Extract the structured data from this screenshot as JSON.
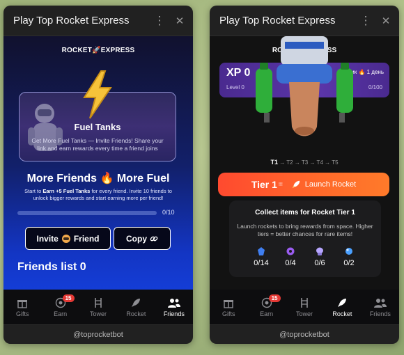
{
  "left": {
    "title": "Play Top Rocket Express",
    "logo": {
      "part1": "ROCKET",
      "part2": "EXPRESS"
    },
    "fuel_card": {
      "title": "Fuel Tanks",
      "desc": "Get More Fuel Tanks — Invite Friends! Share your link and earn rewards every time a friend joins"
    },
    "more_friends": {
      "headline": "More Friends 🔥 More Fuel",
      "desc_pre": "Start to ",
      "desc_bold": "Earn +5 Fuel Tanks",
      "desc_post": " for every friend. Invite 10 friends to unlock bigger rewards and start earning more per friend!"
    },
    "progress": {
      "count": "0/10",
      "fraction": 0
    },
    "invite_label": "Invite",
    "invite_label2": "Friend",
    "copy_label": "Copy",
    "friends_list": "Friends list 0",
    "footer": "@toprocketbot"
  },
  "right": {
    "title": "Play Top Rocket Express",
    "logo": "ROCKET EXPRESS",
    "xp": {
      "title": "XP 0",
      "level": "Level 0",
      "streak": "ик 🔥 1 день",
      "progress": "0/100"
    },
    "tiers": {
      "current": "T1",
      "rest": "→ T2 → T3 → T4 → T5"
    },
    "launch": {
      "tier": "Tier 1",
      "sup": "!!!",
      "label": "Launch Rocket"
    },
    "collect": {
      "title": "Collect items for Rocket Tier 1",
      "desc": "Launch rockets to bring rewards from space. Higher tiers = better chances for rare items!",
      "items": [
        "0/14",
        "0/4",
        "0/6",
        "0/2"
      ]
    },
    "footer": "@toprocketbot"
  },
  "nav": {
    "gifts": "Gifts",
    "earn": "Earn",
    "earn_badge": "15",
    "tower": "Tower",
    "rocket": "Rocket",
    "friends": "Friends"
  },
  "colors": {
    "accent_orange": "#ff5a2c",
    "xp_purple": "#5a35a8",
    "badge_red": "#e53935"
  }
}
